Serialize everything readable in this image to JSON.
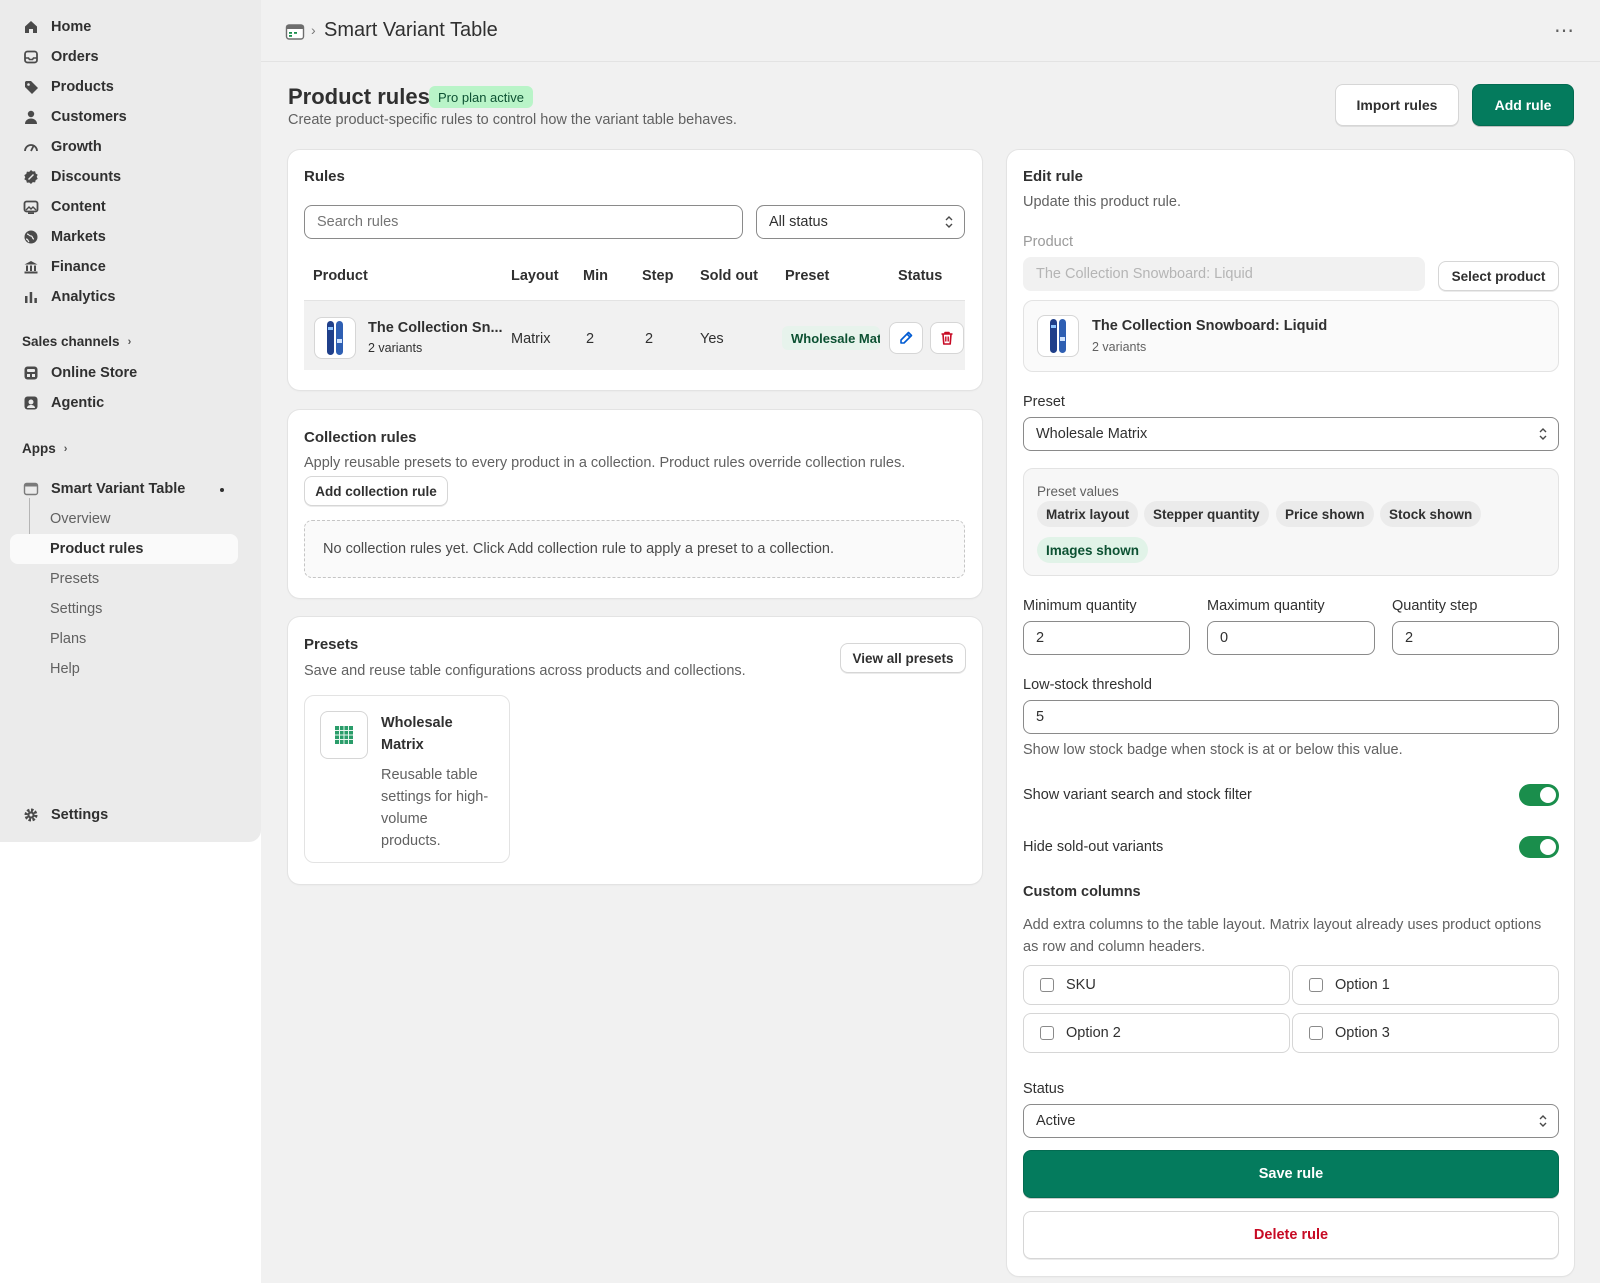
{
  "sidebar": {
    "nav": [
      {
        "label": "Home",
        "icon": "home-icon"
      },
      {
        "label": "Orders",
        "icon": "inbox-icon"
      },
      {
        "label": "Products",
        "icon": "tag-icon"
      },
      {
        "label": "Customers",
        "icon": "person-icon"
      },
      {
        "label": "Growth",
        "icon": "gauge-icon"
      },
      {
        "label": "Discounts",
        "icon": "discount-icon"
      },
      {
        "label": "Content",
        "icon": "image-icon"
      },
      {
        "label": "Markets",
        "icon": "globe-icon"
      },
      {
        "label": "Finance",
        "icon": "bank-icon"
      },
      {
        "label": "Analytics",
        "icon": "bar-chart-icon"
      }
    ],
    "sales_channels": "Sales channels",
    "channels": [
      {
        "label": "Online Store",
        "icon": "store-icon"
      },
      {
        "label": "Agentic",
        "icon": "robot-icon"
      }
    ],
    "apps": "Apps",
    "app_name": "Smart Variant Table",
    "app_sub": [
      "Overview",
      "Product rules",
      "Presets",
      "Settings",
      "Plans",
      "Help"
    ],
    "settings": "Settings"
  },
  "topbar": {
    "title": "Smart Variant Table",
    "more": "⋯"
  },
  "header": {
    "title": "Product rules",
    "badge": "Pro plan active",
    "subtitle": "Create product-specific rules to control how the variant table behaves.",
    "import_label": "Import rules",
    "add_label": "Add rule"
  },
  "rules": {
    "title": "Rules",
    "search_placeholder": "Search rules",
    "status_filter": "All status",
    "columns": [
      "Product",
      "Layout",
      "Min",
      "Step",
      "Sold out",
      "Preset",
      "Status"
    ],
    "row": {
      "product": "The Collection Sn...",
      "variants": "2 variants",
      "layout": "Matrix",
      "min": "2",
      "step": "2",
      "sold_out": "Yes",
      "preset": "Wholesale Matrix"
    }
  },
  "collection_rules": {
    "title": "Collection rules",
    "description": "Apply reusable presets to every product in a collection. Product rules override collection rules.",
    "add_label": "Add collection rule",
    "empty": "No collection rules yet. Click Add collection rule to apply a preset to a collection."
  },
  "presets": {
    "title": "Presets",
    "description": "Save and reuse table configurations across products and collections.",
    "view_all": "View all presets",
    "card_title": "Wholesale Matrix",
    "card_desc": "Reusable table settings for high-volume products."
  },
  "edit_rule": {
    "title": "Edit rule",
    "subtitle": "Update this product rule.",
    "product_label": "Product",
    "product_value": "The Collection Snowboard: Liquid",
    "select_product": "Select product",
    "product_name": "The Collection Snowboard: Liquid",
    "product_variants": "2 variants",
    "preset_label": "Preset",
    "preset_value": "Wholesale Matrix",
    "preset_values_label": "Preset values",
    "tags": [
      "Matrix layout",
      "Stepper quantity",
      "Price shown",
      "Stock shown",
      "Images shown"
    ],
    "min_label": "Minimum quantity",
    "min_value": "2",
    "max_label": "Maximum quantity",
    "max_value": "0",
    "step_label": "Quantity step",
    "step_value": "2",
    "low_stock_label": "Low-stock threshold",
    "low_stock_value": "5",
    "low_stock_help": "Show low stock badge when stock is at or below this value.",
    "toggle_search_label": "Show variant search and stock filter",
    "toggle_hide_label": "Hide sold-out variants",
    "toggle_search_on": true,
    "toggle_hide_on": true,
    "custom_columns_title": "Custom columns",
    "custom_columns_desc": "Add extra columns to the table layout. Matrix layout already uses product options as row and column headers.",
    "columns": [
      "SKU",
      "Option 1",
      "Option 2",
      "Option 3"
    ],
    "status_label": "Status",
    "status_value": "Active",
    "save_label": "Save rule",
    "delete_label": "Delete rule"
  },
  "colors": {
    "primary": "#047b5d",
    "badge_bg": "#b9f4c8",
    "danger": "#c70a24",
    "edit_blue": "#005bd3",
    "toggle_on": "#1a8e4c"
  }
}
